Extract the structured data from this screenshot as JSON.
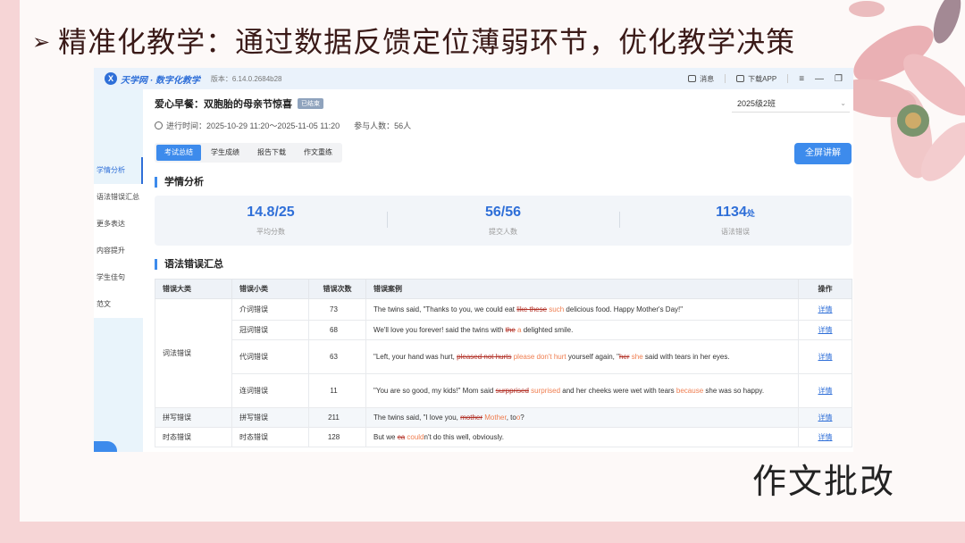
{
  "slide": {
    "heading": "精准化教学：通过数据反馈定位薄弱环节，优化教学决策",
    "heading_marker": "➢",
    "caption": "作文批改"
  },
  "app": {
    "brand": "天学网 · 数字化教学",
    "version": "版本：6.14.0.2684b28",
    "message_label": "消息",
    "download_label": "下载APP",
    "menu_icon": "≡",
    "minimize_icon": "—",
    "restore_icon": "❐",
    "title": "爱心早餐：双胞胎的母亲节惊喜",
    "status_badge": "已结束",
    "class_select": "2025级2班",
    "time_text": "进行时间：2025-10-29 11:20～2025-11-05 11:20",
    "participants": "参与人数：56人",
    "tabs": [
      "考试总结",
      "学生成绩",
      "报告下载",
      "作文重练"
    ],
    "fullscreen": "全屏讲解",
    "sidebar": [
      "学情分析",
      "语法错误汇总",
      "更多表达",
      "内容提升",
      "学生佳句",
      "范文"
    ],
    "section_analysis": "学情分析",
    "stats": [
      {
        "value": "14.8/25",
        "unit": "",
        "label": "平均分数"
      },
      {
        "value": "56/56",
        "unit": "",
        "label": "提交人数"
      },
      {
        "value": "1134",
        "unit": "处",
        "label": "语法错误"
      }
    ],
    "section_errors": "语法错误汇总",
    "table": {
      "headers": [
        "错误大类",
        "错误小类",
        "错误次数",
        "错误案例",
        "操作"
      ],
      "action": "详情",
      "group_1": "词法错误",
      "rows": [
        {
          "sub": "介词错误",
          "count": "73",
          "parts": [
            [
              "The twins said, \"Thanks to you, we could eat ",
              "n"
            ],
            [
              "like these",
              "d"
            ],
            [
              " ",
              "n"
            ],
            [
              "such",
              "i"
            ],
            [
              " delicious food. Happy Mother's Day!\"",
              "n"
            ]
          ]
        },
        {
          "sub": "冠词错误",
          "count": "68",
          "parts": [
            [
              "We'll love you forever! said the twins with ",
              "n"
            ],
            [
              "the",
              "d"
            ],
            [
              " ",
              "n"
            ],
            [
              "a",
              "i"
            ],
            [
              " delighted smile.",
              "n"
            ]
          ]
        },
        {
          "sub": "代词错误",
          "count": "63",
          "parts": [
            [
              "\"Left, your hand was hurt, ",
              "n"
            ],
            [
              "pleased not hurts",
              "d"
            ],
            [
              " ",
              "n"
            ],
            [
              "please don't hurt",
              "i"
            ],
            [
              " yourself again, \"",
              "n"
            ],
            [
              "her",
              "d"
            ],
            [
              " ",
              "n"
            ],
            [
              "she",
              "i"
            ],
            [
              " said with tears in her eyes.",
              "n"
            ]
          ]
        },
        {
          "sub": "连词错误",
          "count": "11",
          "parts": [
            [
              "\"You are so good, my kids!\" Mom said ",
              "n"
            ],
            [
              "surpprised",
              "d"
            ],
            [
              " ",
              "n"
            ],
            [
              "surprised",
              "i"
            ],
            [
              " and her cheeks were wet with tears ",
              "n"
            ],
            [
              "because",
              "i"
            ],
            [
              " she was so happy.",
              "n"
            ]
          ]
        },
        {
          "main": "拼写错误",
          "sub": "拼写错误",
          "count": "211",
          "parts": [
            [
              "The twins said, \"I love you, ",
              "n"
            ],
            [
              "mother",
              "d"
            ],
            [
              " ",
              "n"
            ],
            [
              "Mother",
              "i"
            ],
            [
              ", to",
              "n"
            ],
            [
              "o",
              "i"
            ],
            [
              "?",
              "n"
            ]
          ]
        },
        {
          "main": "时态错误",
          "sub": "时态错误",
          "count": "128",
          "parts": [
            [
              "But we ",
              "n"
            ],
            [
              "ca",
              "d"
            ],
            [
              " ",
              "n"
            ],
            [
              "could",
              "i"
            ],
            [
              "n't do this well, obviously.",
              "n"
            ]
          ]
        }
      ]
    }
  },
  "colors": {
    "accent": "#3d8bec",
    "deleted": "#b3342a",
    "inserted": "#ef7d4f",
    "slide_border": "#f6d5d6"
  }
}
